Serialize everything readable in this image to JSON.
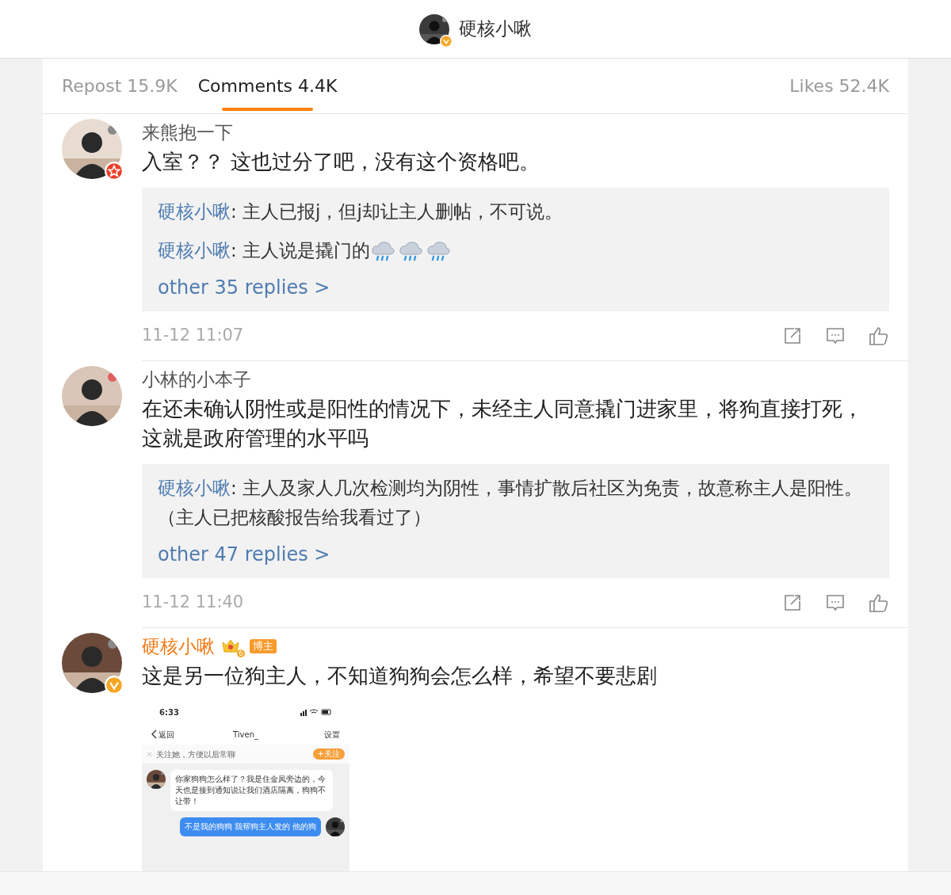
{
  "header": {
    "title": "硬核小啾",
    "verified": true
  },
  "tabs": [
    {
      "label": "Repost 15.9K",
      "selected": false
    },
    {
      "label": "Comments 4.4K",
      "selected": true
    },
    {
      "label": "Likes 52.4K",
      "selected": false
    }
  ],
  "comments": [
    {
      "user": "来熊抱一下",
      "is_author": false,
      "verified": false,
      "member": true,
      "text": "入室？？ 这也过分了吧，没有这个资格吧。",
      "replies": [
        {
          "user": "硬核小啾",
          "text": ": 主人已报j，但j却让主人删帖，不可说。"
        },
        {
          "user": "硬核小啾",
          "text": ": 主人说是撬门的",
          "emojis": [
            {
              "kind": "rain"
            },
            {
              "kind": "rain"
            },
            {
              "kind": "rain"
            }
          ]
        }
      ],
      "more": "other 35 replies >",
      "time": "11-12 11:07"
    },
    {
      "user": "小林的小本子",
      "is_author": false,
      "verified": false,
      "member": false,
      "text": "在还未确认阴性或是阳性的情况下，未经主人同意撬门进家里，将狗直接打死，这就是政府管理的水平吗",
      "replies": [
        {
          "user": "硬核小啾",
          "text": ": 主人及家人几次检测均为阴性，事情扩散后社区为免责，故意称主人是阳性。（主人已把核酸报告给我看过了）"
        }
      ],
      "more": "other 47 replies >",
      "time": "11-12 11:40"
    },
    {
      "user": "硬核小啾",
      "is_author": true,
      "verified": true,
      "member": false,
      "crown_level": "6",
      "tag": "博主",
      "text": "这是另一位狗主人，不知道狗狗会怎么样，希望不要悲剧",
      "screenshot": {
        "time": "6:33",
        "back": "返回",
        "title": "Tiven_",
        "settings": "设置",
        "follow_hint": "关注她，方便以后常聊",
        "follow_button": "+关注",
        "messages": [
          {
            "outgoing": false,
            "text": "你家狗狗怎么样了？我是住金凤旁边的，今天也是接到通知说让我们酒店隔离，狗狗不让带！"
          },
          {
            "outgoing": true,
            "text": "不是我的狗狗 我帮狗主人发的 他的狗"
          }
        ]
      }
    }
  ]
}
